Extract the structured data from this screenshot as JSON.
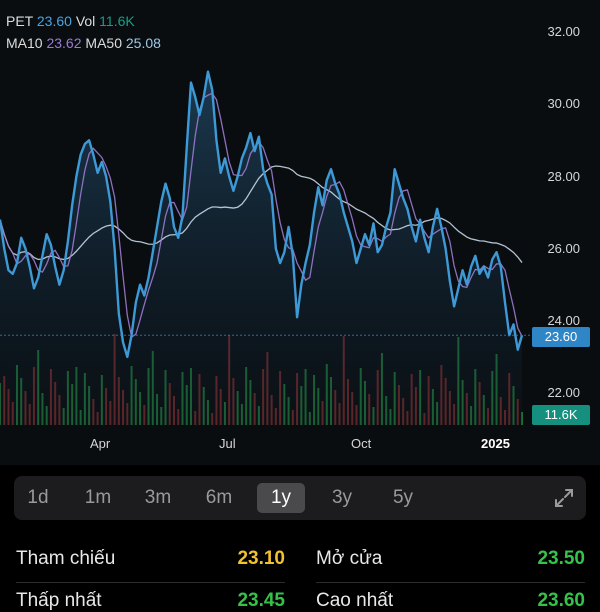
{
  "legend": {
    "symbol": "PET",
    "price": "23.60",
    "vol_label": "Vol",
    "vol_value": "11.6K",
    "ma10_label": "MA10",
    "ma10_value": "23.62",
    "ma50_label": "MA50",
    "ma50_value": "25.08"
  },
  "y_axis_labels": [
    "32.00",
    "30.00",
    "28.00",
    "26.00",
    "24.00",
    "22.00"
  ],
  "x_axis_labels": [
    "Apr",
    "Jul",
    "Oct",
    "2025"
  ],
  "price_badge": "23.60",
  "volume_badge": "11.6K",
  "colors": {
    "price_line": "#3d9ad6",
    "ma10": "#9b7bd0",
    "ma50": "#cfe3f2",
    "price_badge": "#2f86c6",
    "volume_badge": "#15907e",
    "volume_up": "#1f7a3a",
    "volume_down": "#7a2a2a",
    "ref_value": "#f2c12e",
    "open_value": "#35c24a"
  },
  "chart_data": {
    "type": "line",
    "x_labels": [
      "Apr",
      "Jul",
      "Oct",
      "2025"
    ],
    "y_range": [
      21,
      32.5
    ],
    "series": [
      {
        "name": "PET",
        "values": [
          26.8,
          26.0,
          25.4,
          25.3,
          25.6,
          26.3,
          26.0,
          25.5,
          24.9,
          25.2,
          25.8,
          26.4,
          26.1,
          25.5,
          25.0,
          25.4,
          26.2,
          27.2,
          28.0,
          28.6,
          28.9,
          29.0,
          28.6,
          28.1,
          28.4,
          28.0,
          27.3,
          26.0,
          24.2,
          23.4,
          23.0,
          23.6,
          24.5,
          25.0,
          24.7,
          25.2,
          25.9,
          26.6,
          27.3,
          27.8,
          27.4,
          26.6,
          26.3,
          26.9,
          28.8,
          30.6,
          30.2,
          29.7,
          30.2,
          30.9,
          30.4,
          29.0,
          28.1,
          28.5,
          28.0,
          27.6,
          28.0,
          28.5,
          28.8,
          29.2,
          28.7,
          29.1,
          28.2,
          27.8,
          27.5,
          26.0,
          25.6,
          25.9,
          26.6,
          25.8,
          24.1,
          25.0,
          25.6,
          26.1,
          27.0,
          27.7,
          27.2,
          27.9,
          28.2,
          27.8,
          27.5,
          27.0,
          26.6,
          26.2,
          25.6,
          26.0,
          26.4,
          26.1,
          26.7,
          25.9,
          26.1,
          26.6,
          27.0,
          28.2,
          27.8,
          27.4,
          27.1,
          26.6,
          26.2,
          26.8,
          26.3,
          25.9,
          26.6,
          27.1,
          26.6,
          26.0,
          25.1,
          24.4,
          24.9,
          25.4,
          25.0,
          25.5,
          25.8,
          25.3,
          25.5,
          25.2,
          25.7,
          25.9,
          25.5,
          24.5,
          23.6,
          23.9,
          23.2,
          23.6
        ],
        "current": 23.6
      },
      {
        "name": "MA10",
        "current": 23.62
      },
      {
        "name": "MA50",
        "current": 25.08
      }
    ]
  },
  "timeframes": [
    {
      "label": "1d",
      "active": false
    },
    {
      "label": "1m",
      "active": false
    },
    {
      "label": "3m",
      "active": false
    },
    {
      "label": "6m",
      "active": false
    },
    {
      "label": "1y",
      "active": true
    },
    {
      "label": "3y",
      "active": false
    },
    {
      "label": "5y",
      "active": false
    }
  ],
  "stats": {
    "ref_label": "Tham chiếu",
    "ref_value": "23.10",
    "open_label": "Mở cửa",
    "open_value": "23.50",
    "low_label": "Thấp nhất",
    "low_value": "23.45",
    "high_label": "Cao nhất",
    "high_value": "23.60"
  },
  "icons": {
    "expand": "expand-icon"
  }
}
